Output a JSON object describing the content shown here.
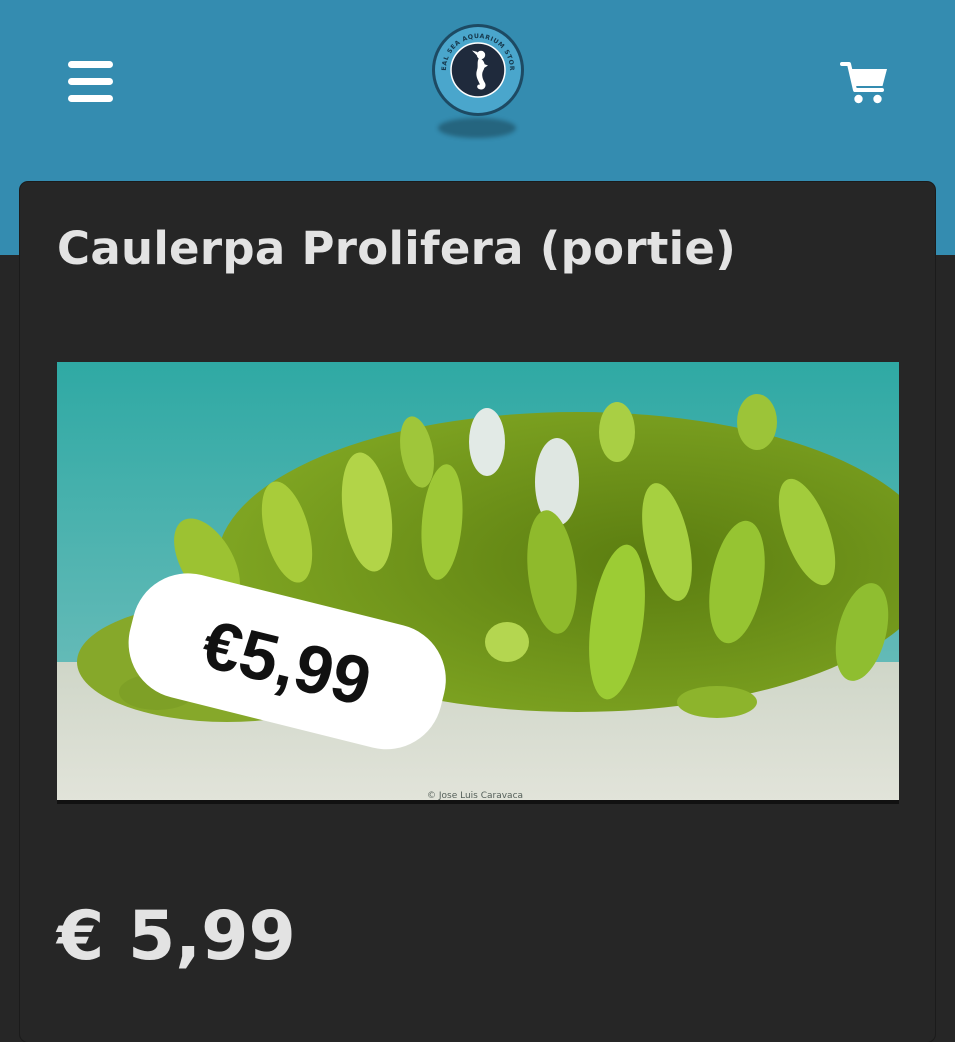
{
  "colors": {
    "brand": "#348cb0",
    "background": "#262626",
    "text": "#e3e3e3"
  },
  "header": {
    "menu_icon": "hamburger-menu-icon",
    "logo": {
      "icon": "seahorse-icon",
      "ring_text": "REAL SEA AQUARIUM STORE"
    },
    "cart_icon": "shopping-cart-icon"
  },
  "product": {
    "title": "Caulerpa Prolifera (portie)",
    "image": {
      "price_sticker": "€5,99",
      "credit": "© Jose Luis Caravaca"
    },
    "price": "€ 5,99"
  }
}
